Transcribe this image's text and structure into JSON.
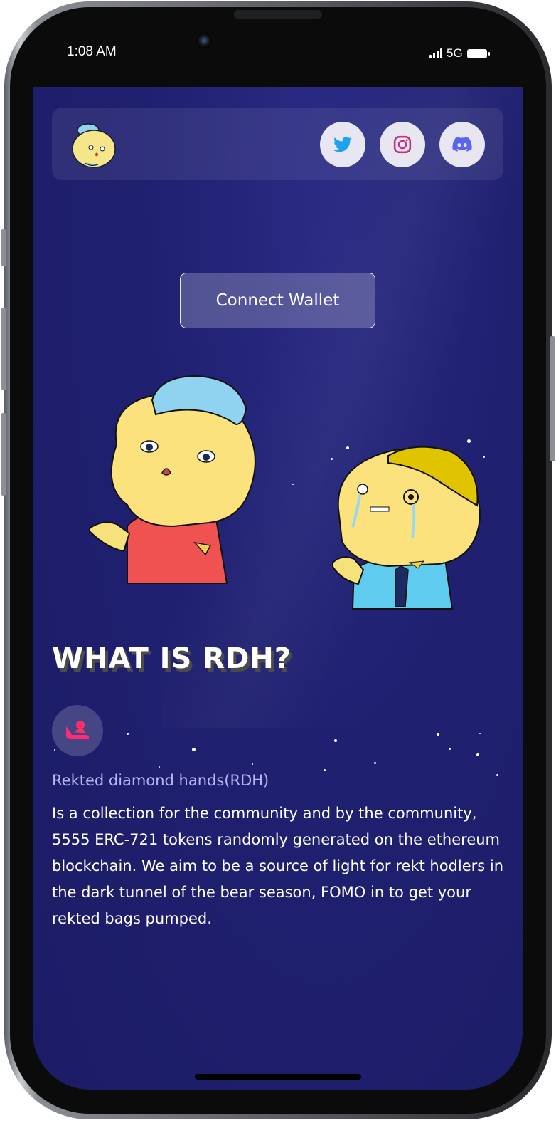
{
  "status_bar": {
    "time": "1:08 AM",
    "network": "5G"
  },
  "header": {
    "logo_icon": "rdh-character-logo",
    "social": [
      {
        "name": "twitter",
        "icon": "twitter-icon",
        "color": "#1da1f2"
      },
      {
        "name": "instagram",
        "icon": "instagram-icon",
        "color": "#c13584"
      },
      {
        "name": "discord",
        "icon": "discord-icon",
        "color": "#5865f2"
      }
    ]
  },
  "hero": {
    "connect_label": "Connect Wallet"
  },
  "about": {
    "heading": "WHAT IS RDH?",
    "badge_icon": "person-reclining-icon",
    "subtitle": "Rekted diamond hands(RDH)",
    "body": "Is a collection for the community and by the community, 5555 ERC-721 tokens randomly generated on the ethereum blockchain. We aim to be a source of light for rekt hodlers in the dark tunnel of the bear season, FOMO in to get your rekted bags pumped."
  },
  "colors": {
    "screen_bg": "#1f2070",
    "accent_pink": "#ff2d6f",
    "subtitle": "#b6b6f2"
  }
}
